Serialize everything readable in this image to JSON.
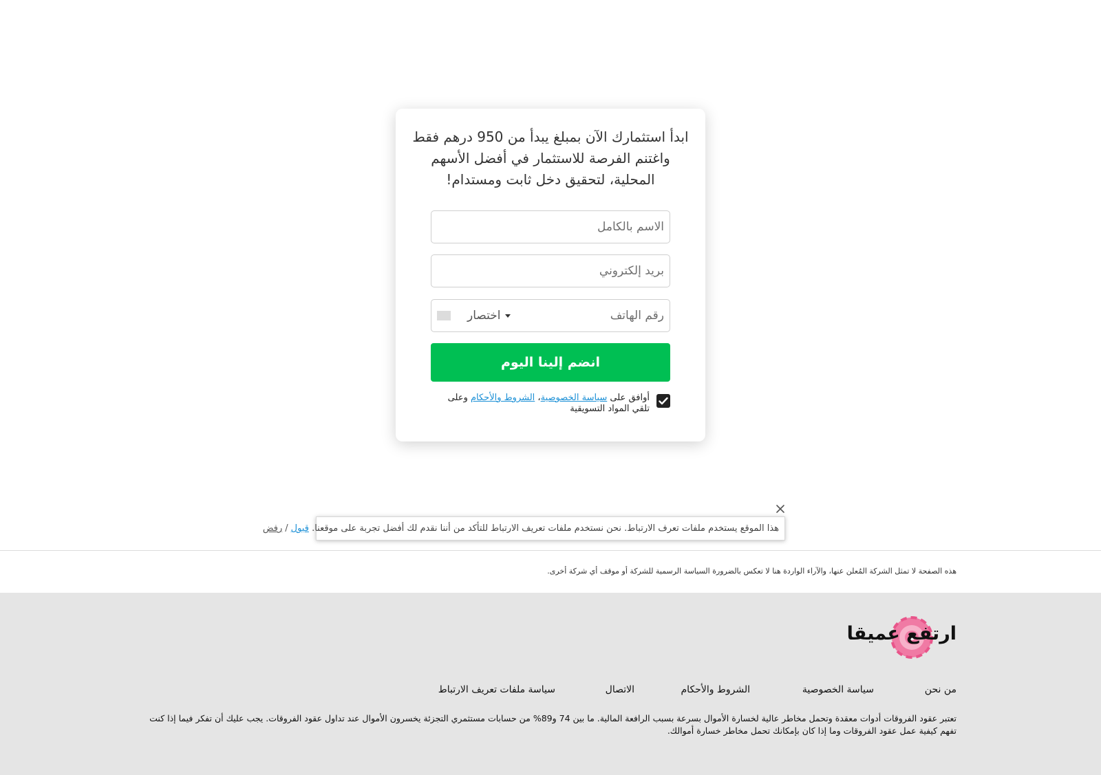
{
  "signup": {
    "headline": "ابدأ استثمارك الآن بمبلغ يبدأ من 950 درهم فقط واغتنم الفرصة للاستثمار في أفضل الأسهم المحلية، لتحقيق دخل ثابت ومستدام!",
    "name_placeholder": "الاسم بالكامل",
    "email_placeholder": "بريد إلكتروني",
    "phone_placeholder": "رقم الهاتف",
    "country_selected": "اختصار",
    "submit_label": "انضم إلينا اليوم",
    "consent_checked": true,
    "consent_prefix": "أوافق على ",
    "privacy_link": "سياسة الخصوصية",
    "consent_separator": "، ",
    "terms_link": "الشروط والأحكام",
    "consent_suffix": " وعلى تلقي المواد التسويقية"
  },
  "cookie_banner": {
    "message": "هذا الموقع يستخدم ملفات تعرف الارتباط. نحن نستخدم ملفات تعريف الارتباط للتأكد من أننا نقدم لك أفضل تجربة على موقعنا.",
    "accept_label": "قبول",
    "separator": "/",
    "reject_label": "رفض"
  },
  "disclaimer": "هذه الصفحة لا تمثل الشركة المُعلن عنها، والآراء الواردة هنا لا تعكس بالضرورة السياسة الرسمية للشركة أو موقف أي شركة أخرى.",
  "footer": {
    "logo_text": "ارتفع عميقا",
    "nav": [
      "من نحن",
      "سياسة الخصوصية",
      "الشروط والأحكام",
      "الاتصال",
      "سياسة ملفات تعريف الارتباط"
    ],
    "risk_warning": "تعتبر عقود الفروقات أدوات معقدة وتحمل مخاطر عالية لخسارة الأموال بسرعة بسبب الرافعة المالية. ما بين 74 و89% من حسابات مستثمري التجزئة يخسرون الأموال عند تداول عقود الفروقات. يجب عليك أن تفكر فيما إذا كنت تفهم كيفية عمل عقود الفروقات وما إذا كان بإمكانك تحمل مخاطر خسارة أموالك."
  },
  "colors": {
    "button_green": "#00bf53",
    "link_blue": "#1a8fd6",
    "footer_bg": "#e5e5e5",
    "logo_pink": "#e8558a"
  }
}
